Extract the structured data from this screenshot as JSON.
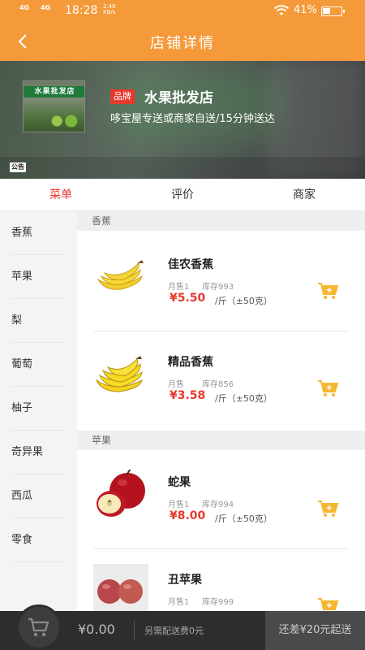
{
  "status_bar": {
    "network1": "4G",
    "network2": "4G",
    "time": "18:28",
    "speed_value": "2.40",
    "speed_unit": "KB/s",
    "battery_percent": "41%",
    "battery_level": 0.41
  },
  "header": {
    "title": "店铺详情",
    "back_icon": "chevron-left-icon"
  },
  "banner": {
    "photo_sign": "水果批发店",
    "brand_badge": "品牌",
    "shop_name": "水果批发店",
    "description": "哆宝屋专送或商家自送/15分钟送达",
    "notice_label": "公告"
  },
  "tabs": [
    {
      "label": "菜单",
      "active": true
    },
    {
      "label": "评价",
      "active": false
    },
    {
      "label": "商家",
      "active": false
    }
  ],
  "categories": [
    {
      "label": "香蕉"
    },
    {
      "label": "苹果"
    },
    {
      "label": "梨"
    },
    {
      "label": "葡萄"
    },
    {
      "label": "柚子"
    },
    {
      "label": "奇异果"
    },
    {
      "label": "西瓜"
    },
    {
      "label": "零食"
    }
  ],
  "sections": [
    {
      "title": "香蕉",
      "items": [
        {
          "name": "佳农香蕉",
          "sales": "月售1",
          "stock": "库存993",
          "price": "¥5.50",
          "unit": "/斤（±50克）",
          "image": "banana"
        },
        {
          "name": "精品香蕉",
          "sales": "月售",
          "stock": "库存856",
          "price": "¥3.58",
          "unit": "/斤（±50克）",
          "image": "banana"
        }
      ]
    },
    {
      "title": "苹果",
      "items": [
        {
          "name": "蛇果",
          "sales": "月售1",
          "stock": "库存994",
          "price": "¥8.00",
          "unit": "/斤（±50克）",
          "image": "red-apple"
        },
        {
          "name": "丑苹果",
          "sales": "月售1",
          "stock": "库存999",
          "price": "",
          "unit": "",
          "image": "apples"
        }
      ]
    }
  ],
  "bottom_bar": {
    "cart_icon": "shopping-cart-icon",
    "total": "¥0.00",
    "shipping_note": "另需配送费0元",
    "checkout_label": "还差¥20元起送"
  },
  "colors": {
    "header_bg": "#f59a3a",
    "accent_red": "#e8392e",
    "cart_icon_yellow": "#f5b72f",
    "bottom_bar_bg": "#2d2d2d"
  }
}
